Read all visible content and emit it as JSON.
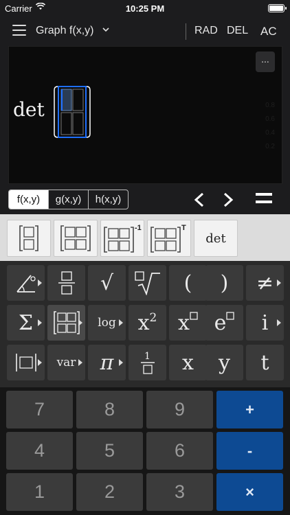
{
  "status": {
    "carrier": "Carrier",
    "time": "10:25 PM",
    "battery_level": 1.0
  },
  "header": {
    "mode_title": "Graph f(x,y)",
    "rad_label": "RAD",
    "del_label": "DEL",
    "ac_label": "AC"
  },
  "display": {
    "more_label": "...",
    "expression_prefix": "det",
    "faint_labels": [
      "0.8",
      "0.6",
      "0.4",
      "0.2"
    ]
  },
  "tabs": [
    {
      "label": "f(x,y)"
    },
    {
      "label": "g(x,y)"
    },
    {
      "label": "h(x,y)"
    }
  ],
  "templates": {
    "det_label": "det",
    "inverse_exp": "-1",
    "transpose_exp": "T"
  },
  "fpad": {
    "r1": {
      "paren_open": "(",
      "paren_close": ")",
      "not_equal": "≠",
      "sqrt": "√"
    },
    "r2": {
      "sigma": "Σ",
      "log": "log",
      "x": "x",
      "sq_exp": "2",
      "e": "e",
      "i": "i"
    },
    "r3": {
      "var": "var",
      "pi": "π",
      "frac_num": "1",
      "x": "x",
      "y": "y",
      "t": "t"
    }
  },
  "npad": {
    "keys": [
      "7",
      "8",
      "9",
      "+",
      "4",
      "5",
      "6",
      "-",
      "1",
      "2",
      "3",
      "×"
    ]
  },
  "colors": {
    "accent_blue": "#0d4a93",
    "matrix_highlight": "#1f6fff"
  }
}
